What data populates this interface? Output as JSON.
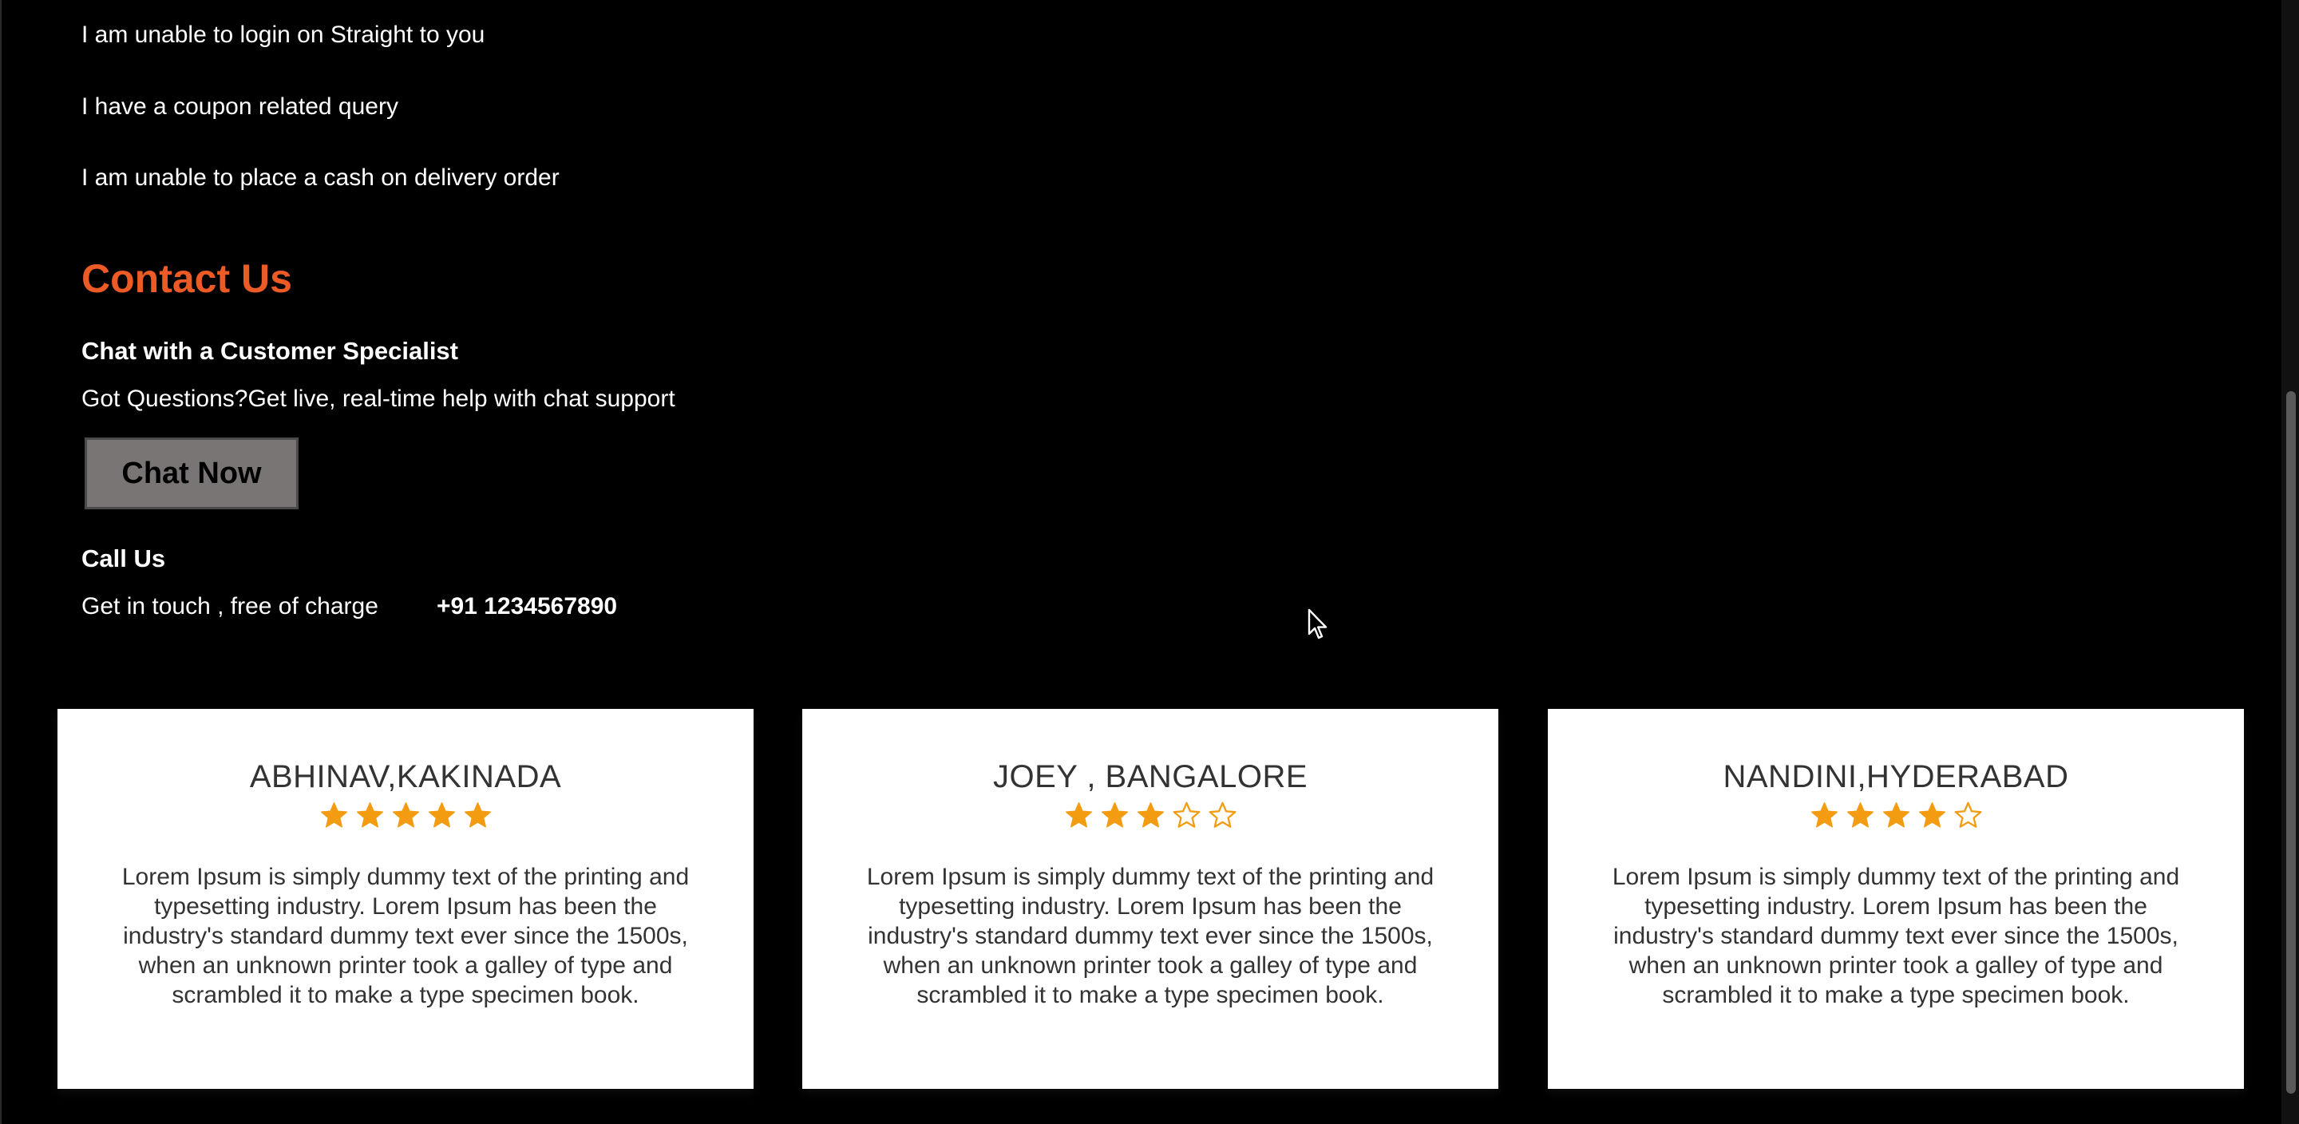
{
  "faq": {
    "items": [
      "I am unable to login on Straight to you",
      "I have a coupon related query",
      "I am unable to place a cash on delivery order"
    ]
  },
  "contact": {
    "heading": "Contact Us",
    "chat_heading": "Chat with a Customer Specialist",
    "chat_text": "Got Questions?Get live, real-time help with chat support",
    "chat_button": "Chat Now",
    "call_heading": "Call Us",
    "call_text": "Get in touch , free of charge",
    "phone": "+91 1234567890"
  },
  "colors": {
    "background": "#000000",
    "accent": "#ec5a25",
    "star": "#f39c12",
    "card_text": "#333333"
  },
  "testimonials": [
    {
      "name": "ABHINAV,KAKINADA",
      "rating": 5,
      "max_rating": 5,
      "text": "Lorem Ipsum is simply dummy text of the printing and typesetting industry. Lorem Ipsum has been the industry's standard dummy text ever since the 1500s, when an unknown printer took a galley of type and scrambled it to make a type specimen book."
    },
    {
      "name": "JOEY , BANGALORE",
      "rating": 3,
      "max_rating": 5,
      "text": "Lorem Ipsum is simply dummy text of the printing and typesetting industry. Lorem Ipsum has been the industry's standard dummy text ever since the 1500s, when an unknown printer took a galley of type and scrambled it to make a type specimen book."
    },
    {
      "name": "NANDINI,HYDERABAD",
      "rating": 4,
      "max_rating": 5,
      "text": "Lorem Ipsum is simply dummy text of the printing and typesetting industry. Lorem Ipsum has been the industry's standard dummy text ever since the 1500s, when an unknown printer took a galley of type and scrambled it to make a type specimen book."
    }
  ]
}
